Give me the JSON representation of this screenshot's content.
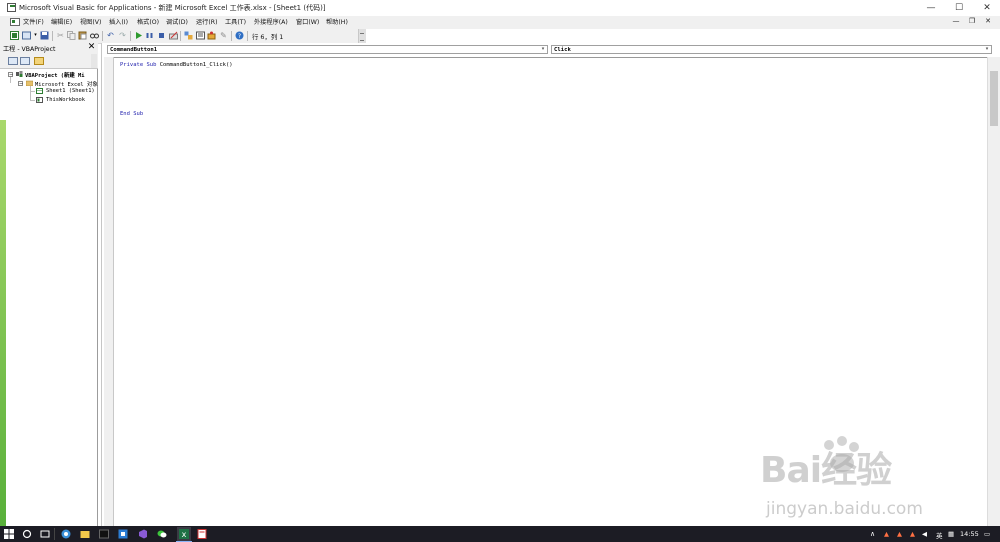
{
  "window": {
    "title": "Microsoft Visual Basic for Applications - 新建 Microsoft Excel 工作表.xlsx - [Sheet1 (代码)]",
    "minimize": "—",
    "maximize": "☐",
    "close": "✕"
  },
  "menu": {
    "items": [
      "文件(F)",
      "编辑(E)",
      "视图(V)",
      "插入(I)",
      "格式(O)",
      "调试(D)",
      "运行(R)",
      "工具(T)",
      "外接程序(A)",
      "窗口(W)",
      "帮助(H)"
    ],
    "mdi_minimize": "—",
    "mdi_restore": "❐",
    "mdi_close": "✕"
  },
  "toolbar": {
    "status": "行 6，列 1"
  },
  "project": {
    "title": "工程 - VBAProject",
    "close": "✕",
    "tree": {
      "root": "VBAProject (新建 Mi",
      "folder": "Microsoft Excel 对象",
      "sheet": "Sheet1 (Sheet1)",
      "workbook": "ThisWorkbook"
    }
  },
  "code_window": {
    "object_combo": "CommandButton1",
    "procedure_combo": "Click",
    "lines": [
      {
        "kw": "Private Sub ",
        "rest": "CommandButton1_Click()"
      },
      {
        "kw": "End Sub",
        "rest": ""
      }
    ]
  },
  "watermark": {
    "brand": "Bai经验",
    "url": "jingyan.baidu.com"
  },
  "taskbar": {
    "ime": "英",
    "time": "14:55"
  },
  "colors": {
    "keyword": "#1b1bab",
    "taskbar": "#1c1c24",
    "chrome": "#f0f0f0"
  }
}
